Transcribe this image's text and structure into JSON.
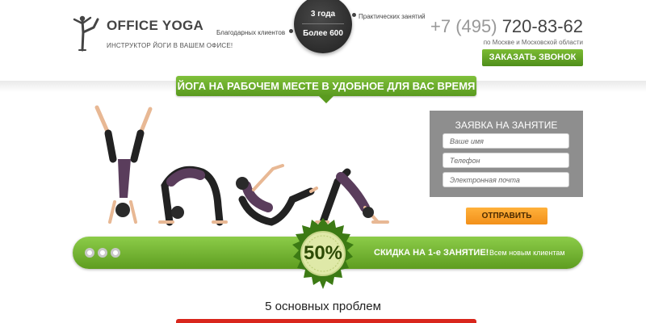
{
  "header": {
    "logo_title": "OFFICE YOGA",
    "logo_subtitle": "ИНСТРУКТОР ЙОГИ В ВАШЕМ ОФИСЕ!",
    "badge_years": "3 года",
    "badge_count": "Более 600",
    "stat_left_label": "Благодарных клиентов",
    "stat_right_label": "Практических занятий",
    "phone_code": "+7 (495)",
    "phone_number": "720-83-62",
    "region": "по Москве и Московской области",
    "call_button": "ЗАКАЗАТЬ ЗВОНОК"
  },
  "hero": {
    "ribbon_text": "ЙОГА НА РАБОЧЕМ МЕСТЕ В УДОБНОЕ ДЛЯ ВАС ВРЕМЯ"
  },
  "form": {
    "title": "ЗАЯВКА НА ЗАНЯТИЕ",
    "name_placeholder": "Ваше имя",
    "phone_placeholder": "Телефон",
    "email_placeholder": "Электронная почта",
    "submit_button": "ОТПРАВИТЬ"
  },
  "promo": {
    "discount": "50%",
    "title": "СКИДКА НА 1-е ЗАНЯТИЕ!",
    "subtitle": "Всем новым клиентам"
  },
  "section": {
    "title": "5 основных проблем"
  },
  "colors": {
    "accent_green": "#6aaa2a",
    "accent_orange": "#f7a12b",
    "form_gray": "#8e8e8e",
    "badge_dark": "#2c2c2c",
    "red_accent": "#d9261c"
  },
  "icons": [
    "yoga-pose-logo-icon",
    "discount-seal-icon"
  ]
}
